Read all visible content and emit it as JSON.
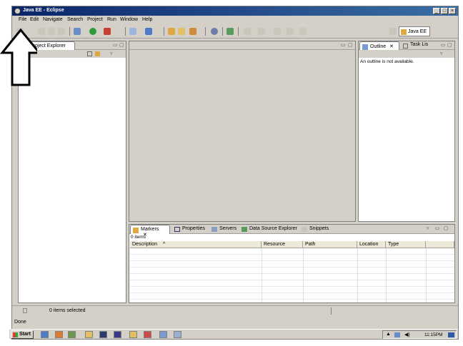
{
  "window": {
    "title": "Java EE - Eclipse"
  },
  "menu": [
    "File",
    "Edit",
    "Navigate",
    "Search",
    "Project",
    "Run",
    "Window",
    "Help"
  ],
  "perspective": {
    "label": "Java EE"
  },
  "project_explorer": {
    "tab": "Project Explorer"
  },
  "outline": {
    "tab": "Outline",
    "other_tab": "Task Lis",
    "message": "An outline is not available."
  },
  "bottom_tabs": [
    "Markers",
    "Properties",
    "Servers",
    "Data Source Explorer",
    "Snippets"
  ],
  "markers": {
    "count_label": "0 items",
    "columns": [
      "Description",
      "Resource",
      "Path",
      "Location",
      "Type"
    ]
  },
  "status": {
    "selection": "0 items selected",
    "bottom": "Done"
  },
  "taskbar": {
    "start": "Start",
    "time": "11:15PM"
  },
  "colors": {
    "title_bar": "#0a246a",
    "window_bg": "#d4d0c8"
  }
}
